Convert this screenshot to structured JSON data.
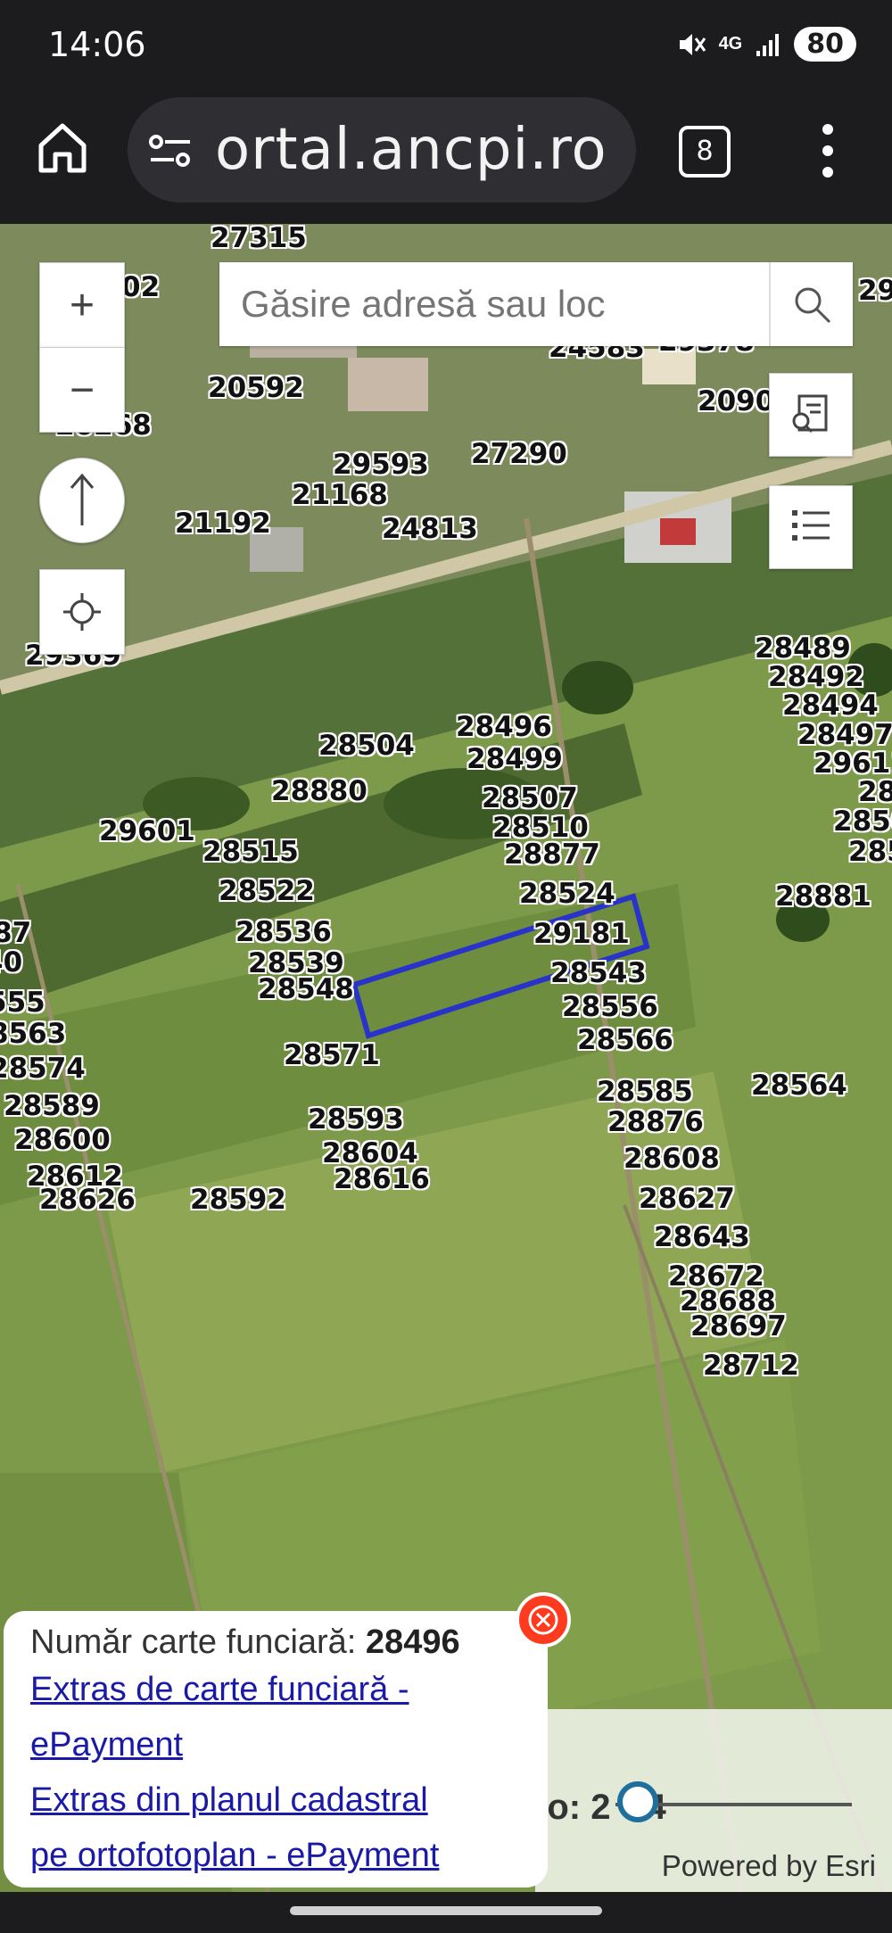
{
  "status": {
    "time": "14:06",
    "network": "4G",
    "battery": "80"
  },
  "browser": {
    "url": "ortal.ancpi.ro",
    "tab_count": "8"
  },
  "search": {
    "placeholder": "Găsire adresă sau loc"
  },
  "map_controls": {
    "zoom_in": "+",
    "zoom_out": "−"
  },
  "parcel_labels": [
    "27315",
    "02",
    "29",
    "24583",
    "29378",
    "20592",
    "2090",
    "20268",
    "27290",
    "29593",
    "21168",
    "21192",
    "24813",
    "29369",
    "28489",
    "28492",
    "28494",
    "28497",
    "29611",
    "2850",
    "2850",
    "285",
    "28504",
    "28496",
    "28499",
    "28880",
    "28507",
    "28510",
    "28877",
    "29601",
    "28515",
    "28522",
    "28524",
    "28881",
    "28536",
    "29181",
    "87",
    "28539",
    "28548",
    "40",
    "28543",
    "555",
    "28556",
    "8563",
    "28566",
    "28574",
    "28571",
    "28564",
    "28589",
    "28585",
    "28593",
    "28876",
    "28600",
    "28604",
    "28608",
    "28612",
    "28616",
    "28627",
    "28643",
    "28672",
    "28688",
    "28697",
    "28712",
    "28626",
    "28592"
  ],
  "timeline": {
    "label_visible": "to: 2",
    "label_tail": "4"
  },
  "attribution": "Powered by Esri",
  "popup": {
    "title_prefix": "Număr carte funciară: ",
    "title_number": "28496",
    "link1_line1": "Extras de carte funciară -",
    "link1_line2": "ePayment",
    "link2_line1": "Extras din planul cadastral",
    "link2_line2": "pe ortofotoplan - ePayment"
  },
  "colors": {
    "parcel_outline": "#2a33c9",
    "close_button": "#ff3b1f",
    "link": "#1a1aa6"
  }
}
